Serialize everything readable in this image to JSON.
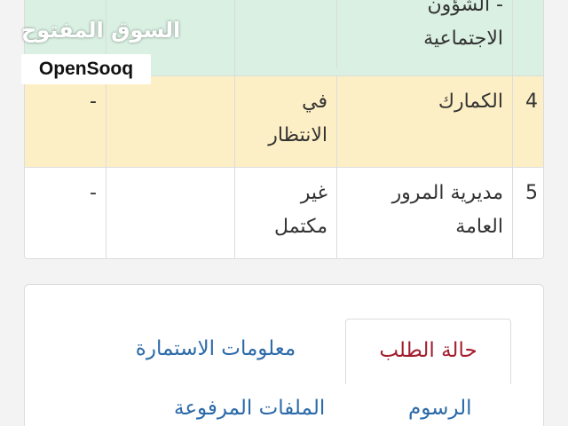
{
  "table": {
    "rows": [
      {
        "number": "",
        "entity_line1": "- الشؤون",
        "entity_line2": "الاجتماعية",
        "status_line1": "",
        "status_line2": "",
        "col4": "",
        "col5": ""
      },
      {
        "number": "4",
        "entity_line1": "الكمارك",
        "entity_line2": "",
        "status_line1": "في",
        "status_line2": "الانتظار",
        "col4": "",
        "col5": "-"
      },
      {
        "number": "5",
        "entity_line1": "مديرية المرور",
        "entity_line2": "العامة",
        "status_line1": "غير",
        "status_line2": "مكتمل",
        "col4": "",
        "col5": "-"
      }
    ],
    "row_colors": [
      "#d9f0e2",
      "#fdefc5",
      "#ffffff"
    ]
  },
  "watermark": {
    "arabic": "السوق المفتوح",
    "english": "OpenSooq"
  },
  "tabs": {
    "request_status": "حالة الطلب",
    "form_info": "معلومات الاستمارة",
    "fees": "الرسوم",
    "uploaded_files": "الملفات المرفوعة"
  },
  "colors": {
    "active_tab": "#a31c2e",
    "link": "#2b6aa8"
  }
}
